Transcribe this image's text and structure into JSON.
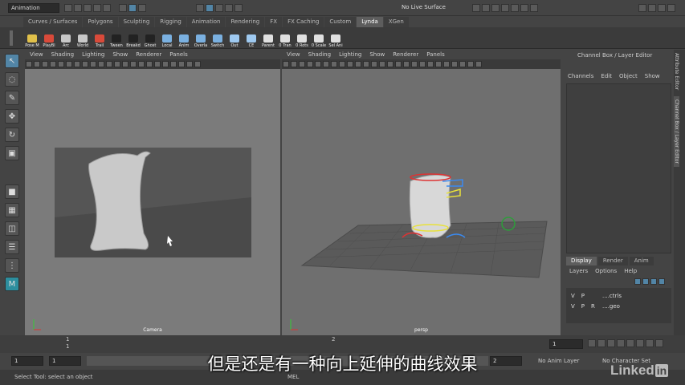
{
  "status_bar": {
    "mode": "Animation",
    "live_surface": "No Live Surface"
  },
  "shelf_tabs": [
    "Curves / Surfaces",
    "Polygons",
    "Sculpting",
    "Rigging",
    "Animation",
    "Rendering",
    "FX",
    "FX Caching",
    "Custom",
    "Lynda",
    "XGen"
  ],
  "active_shelf_tab": "Lynda",
  "shelf_buttons": [
    {
      "label": "Pose M",
      "color": "#e0c04a"
    },
    {
      "label": "PlayBl",
      "color": "#d94a3a"
    },
    {
      "label": "Arc",
      "color": "#c8c8c8"
    },
    {
      "label": "World",
      "color": "#c8c8c8"
    },
    {
      "label": "Trail",
      "color": "#d94a3a"
    },
    {
      "label": "Tween",
      "color": "#222222"
    },
    {
      "label": "Breakd",
      "color": "#222222"
    },
    {
      "label": "Ghost",
      "color": "#222222"
    },
    {
      "label": "Local",
      "color": "#7ab0e0"
    },
    {
      "label": "Anim",
      "color": "#7ab0e0"
    },
    {
      "label": "Overla",
      "color": "#7ab0e0"
    },
    {
      "label": "Switch",
      "color": "#7ab0e0"
    },
    {
      "label": "Out",
      "color": "#9ec9f0"
    },
    {
      "label": "CE",
      "color": "#9ec9f0"
    },
    {
      "label": "Parent",
      "color": "#e0e0e0"
    },
    {
      "label": "0 Tran",
      "color": "#e0e0e0"
    },
    {
      "label": "0 Rots",
      "color": "#e0e0e0"
    },
    {
      "label": "0 Scale",
      "color": "#e0e0e0"
    },
    {
      "label": "Sel Ani",
      "color": "#e0e0e0"
    }
  ],
  "panel_menus": [
    "View",
    "Shading",
    "Lighting",
    "Show",
    "Renderer",
    "Panels"
  ],
  "left_panel": {
    "camera_label": "Camera"
  },
  "right_panel": {
    "camera_label": "persp"
  },
  "channel_box": {
    "title": "Channel Box / Layer Editor",
    "menus": [
      "Channels",
      "Edit",
      "Object",
      "Show"
    ],
    "display_tabs": [
      "Display",
      "Render",
      "Anim"
    ],
    "layer_menus": [
      "Layers",
      "Options",
      "Help"
    ],
    "layers": [
      {
        "v": "V",
        "p": "P",
        "r": "",
        "name": "....ctrls"
      },
      {
        "v": "V",
        "p": "P",
        "r": "R",
        "name": "....geo"
      }
    ]
  },
  "side_tabs": [
    "Attribute Editor",
    "Channel Box / Layer Editor"
  ],
  "time_slider": {
    "ticks": [
      "1",
      "2"
    ],
    "current_frame": "1"
  },
  "range_row": {
    "start": "1",
    "start2": "1",
    "end": "2",
    "anim_layer": "No Anim Layer",
    "char_set": "No Character Set"
  },
  "command_line": {
    "help": "Select Tool: select an object",
    "lang": "MEL"
  },
  "subtitle": "但是还是有一种向上延伸的曲线效果",
  "watermark": {
    "text": "Linked",
    "badge": "in"
  }
}
